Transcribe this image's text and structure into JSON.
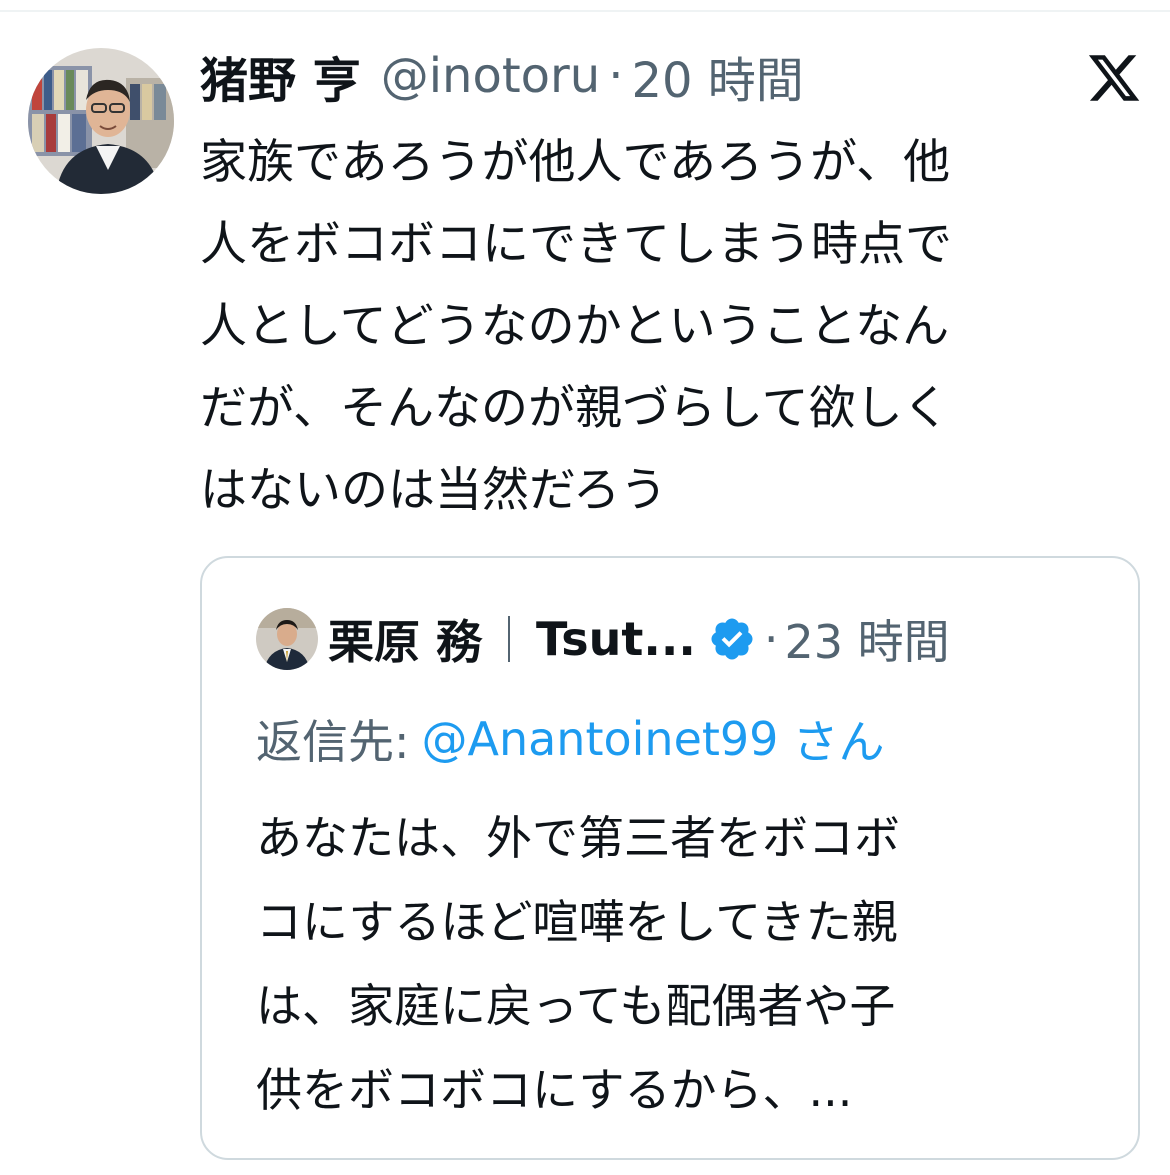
{
  "tweet": {
    "author_name": "猪野 亨",
    "author_handle": "@inotoru",
    "separator": "·",
    "timestamp": "20 時間",
    "platform_logo": "x-logo-icon",
    "body_lines": [
      "家族であろうが他人であろうが、他",
      "人をボコボコにできてしまう時点で",
      "人としてどうなのかということなん",
      "だが、そんなのが親づらして欲しく",
      "はないのは当然だろう"
    ]
  },
  "quoted_tweet": {
    "author_name": "栗原 務",
    "author_name_truncated": "Tsut...",
    "verified_icon": "verified-badge-icon",
    "separator": "·",
    "timestamp": "23 時間",
    "reply_label": "返信先:",
    "reply_handle": "@Anantoinet99",
    "reply_suffix": "さん",
    "body_lines": [
      "あなたは、外で第三者をボコボ",
      "コにするほど喧嘩をしてきた親",
      "は、家庭に戻っても配偶者や子",
      "供をボコボコにするから、..."
    ]
  },
  "colors": {
    "text_primary": "#0f1419",
    "text_secondary": "#536471",
    "link": "#1d9bf0",
    "border": "#cfd9de"
  }
}
